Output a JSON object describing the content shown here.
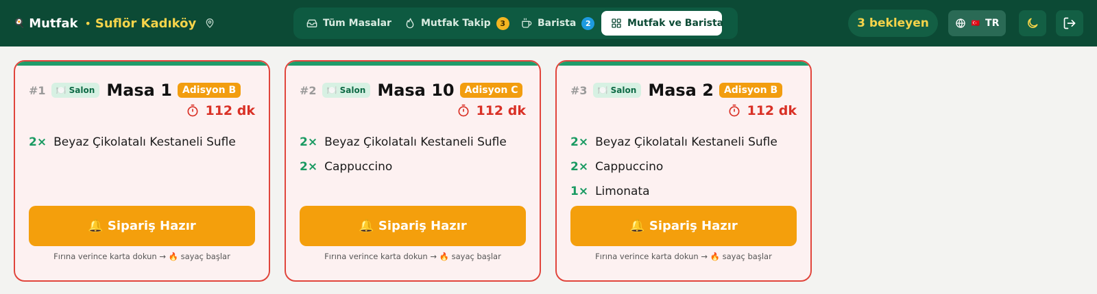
{
  "header": {
    "brand_logo": "🍳",
    "brand_name": "Mutfak",
    "brand_separator": "•",
    "branch_name": "Suflör Kadıköy",
    "tabs": [
      {
        "label": "Tüm Masalar",
        "icon": "inbox-icon",
        "badge": ""
      },
      {
        "label": "Mutfak Takip",
        "icon": "flame-icon",
        "badge": "3"
      },
      {
        "label": "Barista",
        "icon": "coffee-icon",
        "badge": "2"
      },
      {
        "label": "Mutfak ve Barista",
        "icon": "grid-icon",
        "badge": "",
        "active": true
      }
    ],
    "pending_label": "3 bekleyen",
    "language": {
      "flag": "🇹🇷",
      "code": "TR"
    }
  },
  "colors": {
    "header_bg": "#0c4a35",
    "accent_yellow": "#f6d44a",
    "card_border": "#e0443b",
    "card_strip": "#1f9d6b",
    "ready_button": "#f49f0c",
    "timer_red": "#d93025",
    "qty_green": "#1a9a62"
  },
  "orders": [
    {
      "number": "#1",
      "area": "🍽️ Salon",
      "table": "Masa 1",
      "check": "Adisyon B",
      "elapsed": "112 dk",
      "items": [
        {
          "qty": "2×",
          "name": "Beyaz Çikolatalı Kestaneli Sufle"
        }
      ],
      "ready_label": "🔔 Sipariş Hazır",
      "hint": "Fırına verince karta dokun → 🔥 sayaç başlar"
    },
    {
      "number": "#2",
      "area": "🍽️ Salon",
      "table": "Masa 10",
      "check": "Adisyon C",
      "elapsed": "112 dk",
      "items": [
        {
          "qty": "2×",
          "name": "Beyaz Çikolatalı Kestaneli Sufle"
        },
        {
          "qty": "2×",
          "name": "Cappuccino"
        }
      ],
      "ready_label": "🔔 Sipariş Hazır",
      "hint": "Fırına verince karta dokun → 🔥 sayaç başlar"
    },
    {
      "number": "#3",
      "area": "🍽️ Salon",
      "table": "Masa 2",
      "check": "Adisyon B",
      "elapsed": "112 dk",
      "items": [
        {
          "qty": "2×",
          "name": "Beyaz Çikolatalı Kestaneli Sufle"
        },
        {
          "qty": "2×",
          "name": "Cappuccino"
        },
        {
          "qty": "1×",
          "name": "Limonata"
        }
      ],
      "ready_label": "🔔 Sipariş Hazır",
      "hint": "Fırına verince karta dokun → 🔥 sayaç başlar"
    }
  ]
}
